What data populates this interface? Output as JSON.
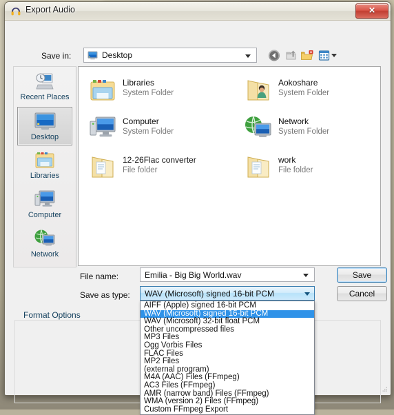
{
  "window": {
    "title": "Export Audio",
    "app_icon": "audacity-headphones-icon",
    "close_label": "✕"
  },
  "toolbar": {
    "save_in_label": "Save in:",
    "save_in_value": "Desktop",
    "buttons": [
      {
        "name": "back-button",
        "tooltip": "Back"
      },
      {
        "name": "up-folder-button",
        "tooltip": "Up One Level"
      },
      {
        "name": "new-folder-button",
        "tooltip": "Create New Folder"
      },
      {
        "name": "views-button",
        "tooltip": "Views"
      }
    ]
  },
  "places": [
    {
      "label": "Recent Places",
      "icon": "recent-places-icon",
      "selected": false
    },
    {
      "label": "Desktop",
      "icon": "desktop-icon",
      "selected": true
    },
    {
      "label": "Libraries",
      "icon": "libraries-icon",
      "selected": false
    },
    {
      "label": "Computer",
      "icon": "computer-icon",
      "selected": false
    },
    {
      "label": "Network",
      "icon": "network-icon",
      "selected": false
    }
  ],
  "files": [
    {
      "name": "Libraries",
      "subtitle": "System Folder",
      "icon": "libraries-folder-icon"
    },
    {
      "name": "Aokoshare",
      "subtitle": "System Folder",
      "icon": "user-folder-icon"
    },
    {
      "name": "Computer",
      "subtitle": "System Folder",
      "icon": "computer-icon"
    },
    {
      "name": "Network",
      "subtitle": "System Folder",
      "icon": "network-icon"
    },
    {
      "name": "12-26Flac converter",
      "subtitle": "File folder",
      "icon": "folder-icon"
    },
    {
      "name": "work",
      "subtitle": "File folder",
      "icon": "folder-icon"
    }
  ],
  "fields": {
    "file_name_label": "File name:",
    "file_name_value": "Emilia - Big Big World.wav",
    "save_as_type_label": "Save as type:",
    "save_as_type_value": "WAV (Microsoft) signed 16-bit PCM"
  },
  "buttons": {
    "save": "Save",
    "cancel": "Cancel"
  },
  "format_options": {
    "title": "Format Options"
  },
  "type_dropdown": {
    "selected_index": 1,
    "options": [
      "AIFF (Apple) signed 16-bit PCM",
      "WAV (Microsoft) signed 16-bit PCM",
      "WAV (Microsoft) 32-bit float PCM",
      "Other uncompressed files",
      "MP3 Files",
      "Ogg Vorbis Files",
      "FLAC Files",
      "MP2 Files",
      "(external program)",
      "M4A (AAC) Files (FFmpeg)",
      "AC3 Files (FFmpeg)",
      "AMR (narrow band) Files (FFmpeg)",
      "WMA (version 2) Files (FFmpeg)",
      "Custom FFmpeg Export"
    ]
  },
  "colors": {
    "selection_blue": "#2f92e8",
    "focus_border": "#3c7fb1",
    "label_blue": "#16425f",
    "close_red": "#c23f32"
  }
}
